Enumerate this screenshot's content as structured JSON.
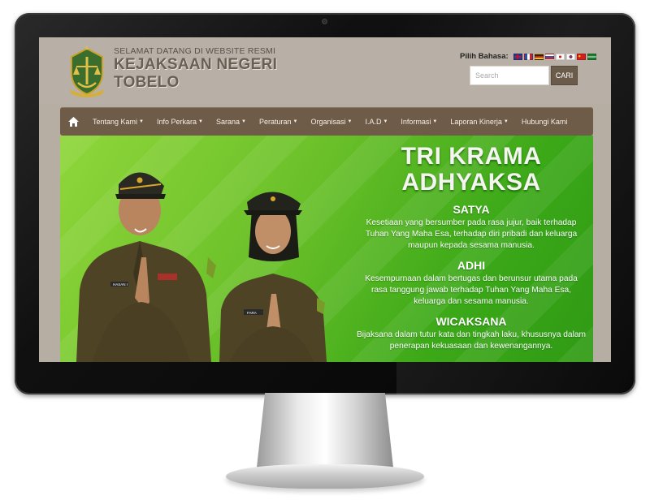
{
  "header": {
    "tagline": "SELAMAT DATANG DI WEBSITE RESMI",
    "site_name_line1": "KEJAKSAAN NEGERI",
    "site_name_line2": "TOBELO",
    "language_label": "Pilih Bahasa:",
    "languages": [
      {
        "icon": "flag-uk-icon",
        "color": "#1d3d8f"
      },
      {
        "icon": "flag-fr-icon",
        "color": "#2d4fa8"
      },
      {
        "icon": "flag-de-icon",
        "color": "#222222"
      },
      {
        "icon": "flag-ru-icon",
        "color": "#3355aa"
      },
      {
        "icon": "flag-jp-icon",
        "color": "#ffffff"
      },
      {
        "icon": "flag-kr-icon",
        "color": "#ffffff"
      },
      {
        "icon": "flag-cn-icon",
        "color": "#d21f1f"
      },
      {
        "icon": "flag-sa-icon",
        "color": "#1e7a2e"
      }
    ],
    "search_placeholder": "Search",
    "search_button": "CARI"
  },
  "nav": {
    "home_icon": "home-icon",
    "items": [
      {
        "label": "Tentang Kami",
        "dropdown": true
      },
      {
        "label": "Info Perkara",
        "dropdown": true
      },
      {
        "label": "Sarana",
        "dropdown": true
      },
      {
        "label": "Peraturan",
        "dropdown": true
      },
      {
        "label": "Organisasi",
        "dropdown": true
      },
      {
        "label": "I.A.D",
        "dropdown": true
      },
      {
        "label": "Informasi",
        "dropdown": true
      },
      {
        "label": "Laporan Kinerja",
        "dropdown": true
      },
      {
        "label": "Hubungi Kami",
        "dropdown": false
      }
    ]
  },
  "hero": {
    "title_line1": "TRI KRAMA",
    "title_line2": "ADHYAKSA",
    "virtues": [
      {
        "name": "SATYA",
        "desc": "Kesetiaan yang bersumber pada rasa jujur, baik terhadap Tuhan Yang Maha Esa, terhadap diri pribadi dan keluarga maupun kepada sesama manusia."
      },
      {
        "name": "ADHI",
        "desc": "Kesempurnaan dalam bertugas dan berunsur utama pada rasa tanggung jawab terhadap Tuhan Yang Maha Esa,  keluarga dan sesama manusia."
      },
      {
        "name": "WICAKSANA",
        "desc": "Bijaksana dalam tutur kata dan tingkah laku, khususnya dalam penerapan kekuasaan dan kewenangannya."
      }
    ],
    "badge_left": "HASAN I",
    "badge_right": "FARA"
  },
  "colors": {
    "header_bg": "#b8b0a6",
    "nav_bg": "#6e5b48",
    "hero_green": "#6cc12a",
    "uniform": "#4f4326"
  }
}
